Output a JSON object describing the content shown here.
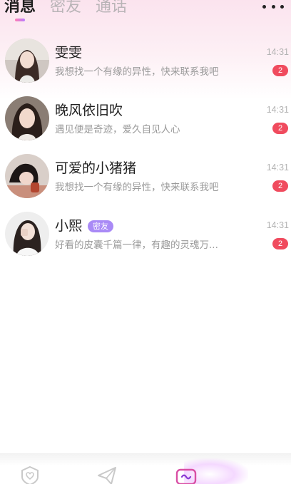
{
  "header": {
    "tabs": [
      {
        "label": "消息",
        "active": true
      },
      {
        "label": "密友",
        "active": false
      },
      {
        "label": "通话",
        "active": false
      }
    ],
    "more_icon": "more-dots-icon"
  },
  "conversations": [
    {
      "name": "雯雯",
      "preview": "我想找一个有缘的异性，快来联系我吧",
      "time": "14:31",
      "unread": "2",
      "tag": ""
    },
    {
      "name": "晚风依旧吹",
      "preview": "遇见便是奇迹，爱久自见人心",
      "time": "14:31",
      "unread": "2",
      "tag": ""
    },
    {
      "name": "可爱的小猪猪",
      "preview": "我想找一个有缘的异性，快来联系我吧",
      "time": "14:31",
      "unread": "2",
      "tag": ""
    },
    {
      "name": "小熙",
      "preview": "好看的皮囊千篇一律，有趣的灵魂万...",
      "time": "14:31",
      "unread": "2",
      "tag": "密友"
    }
  ],
  "bottom_nav": {
    "items": [
      {
        "icon": "heart-shield-icon",
        "active": false
      },
      {
        "icon": "paper-plane-icon",
        "active": false
      },
      {
        "icon": "message-icon",
        "active": true
      }
    ]
  },
  "colors": {
    "accent_pink": "#ff7eb3",
    "accent_purple": "#b97cff",
    "badge_red": "#f04b5e",
    "friend_tag": "#a98af6"
  }
}
